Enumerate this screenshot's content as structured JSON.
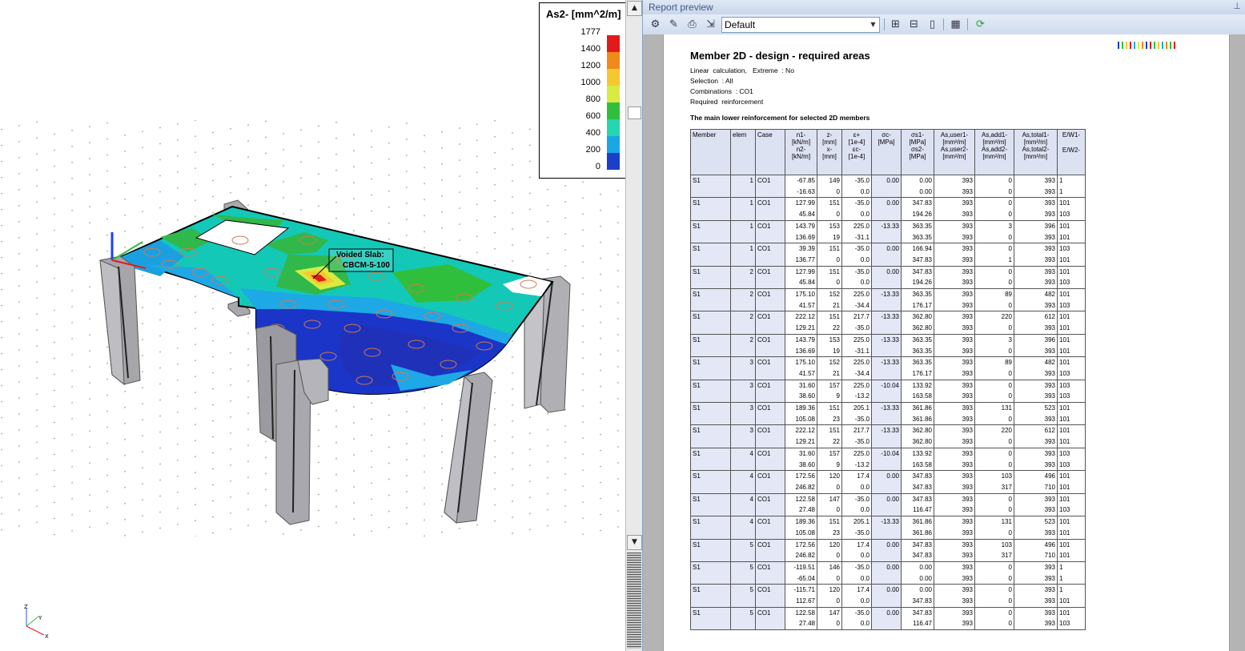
{
  "viewport": {
    "annotation": [
      "Voided Slab:",
      "CBCM-5-100"
    ],
    "axes": {
      "x": "X",
      "y": "Y",
      "z": "Z"
    },
    "legend": {
      "title": "As2- [mm^2/m]",
      "levels": [
        {
          "value": "1777",
          "color": "#e31a1c"
        },
        {
          "value": "1400",
          "color": "#f08a1a"
        },
        {
          "value": "1200",
          "color": "#f6c830"
        },
        {
          "value": "1000",
          "color": "#d9ea40"
        },
        {
          "value": "800",
          "color": "#2fbf3c"
        },
        {
          "value": "600",
          "color": "#25d6b0"
        },
        {
          "value": "400",
          "color": "#1aa7e6"
        },
        {
          "value": "200",
          "color": "#1a3fc8"
        },
        {
          "value": "0",
          "color": "#0d1fa0"
        }
      ]
    }
  },
  "scrollbar": {
    "up": "▲",
    "down": "▼"
  },
  "report": {
    "panel_title": "Report preview",
    "pin_icon": "⊥",
    "template_select": "Default",
    "title": "Member 2D - design - required areas",
    "info_lines": [
      "Linear  calculation,   Extreme  : No",
      "Selection  : All",
      "Combinations  : CO1",
      "Required  reinforcement"
    ],
    "subtitle": "The main  lower  reinforcement   for selected  2D members",
    "columns": [
      [
        "Member"
      ],
      [
        "elem"
      ],
      [
        "Case"
      ],
      [
        "n1-",
        "[kN/m]",
        "n2-",
        "[kN/m]"
      ],
      [
        "z-",
        "[mm]",
        "x-",
        "[mm]"
      ],
      [
        "ε+",
        "[1e-4]",
        "εc-",
        "[1e-4]"
      ],
      [
        "σc-",
        "[MPa]"
      ],
      [
        "σs1-",
        "[MPa]",
        "σs2-",
        "[MPa]"
      ],
      [
        "As,user1-",
        "[mm²/m]",
        "As,user2-",
        "[mm²/m]"
      ],
      [
        "As,add1-",
        "[mm²/m]",
        "As,add2-",
        "[mm²/m]"
      ],
      [
        "As,total1-",
        "[mm²/m]",
        "As,total2-",
        "[mm²/m]"
      ],
      [
        "E/W1-",
        "",
        "E/W2-"
      ]
    ],
    "rows": [
      {
        "member": "S1",
        "elem": "1",
        "case": "CO1",
        "a": [
          "-67.85",
          "149",
          "-35.0",
          "0.00",
          "0.00",
          "393",
          "0",
          "393",
          "1"
        ],
        "b": [
          "-16.63",
          "0",
          "0.0",
          "",
          "0.00",
          "393",
          "0",
          "393",
          "1"
        ]
      },
      {
        "member": "S1",
        "elem": "1",
        "case": "CO1",
        "a": [
          "127.99",
          "151",
          "-35.0",
          "0.00",
          "347.83",
          "393",
          "0",
          "393",
          "101"
        ],
        "b": [
          "45.84",
          "0",
          "0.0",
          "",
          "194.26",
          "393",
          "0",
          "393",
          "103"
        ]
      },
      {
        "member": "S1",
        "elem": "1",
        "case": "CO1",
        "a": [
          "143.79",
          "153",
          "225.0",
          "-13.33",
          "363.35",
          "393",
          "3",
          "396",
          "101"
        ],
        "b": [
          "136.69",
          "19",
          "-31.1",
          "",
          "363.35",
          "393",
          "0",
          "393",
          "101"
        ]
      },
      {
        "member": "S1",
        "elem": "1",
        "case": "CO1",
        "a": [
          "39.39",
          "151",
          "-35.0",
          "0.00",
          "166.94",
          "393",
          "0",
          "393",
          "103"
        ],
        "b": [
          "136.77",
          "0",
          "0.0",
          "",
          "347.83",
          "393",
          "1",
          "393",
          "101"
        ]
      },
      {
        "member": "S1",
        "elem": "2",
        "case": "CO1",
        "a": [
          "127.99",
          "151",
          "-35.0",
          "0.00",
          "347.83",
          "393",
          "0",
          "393",
          "101"
        ],
        "b": [
          "45.84",
          "0",
          "0.0",
          "",
          "194.26",
          "393",
          "0",
          "393",
          "103"
        ]
      },
      {
        "member": "S1",
        "elem": "2",
        "case": "CO1",
        "a": [
          "175.10",
          "152",
          "225.0",
          "-13.33",
          "363.35",
          "393",
          "89",
          "482",
          "101"
        ],
        "b": [
          "41.57",
          "21",
          "-34.4",
          "",
          "176.17",
          "393",
          "0",
          "393",
          "103"
        ]
      },
      {
        "member": "S1",
        "elem": "2",
        "case": "CO1",
        "a": [
          "222.12",
          "151",
          "217.7",
          "-13.33",
          "362.80",
          "393",
          "220",
          "612",
          "101"
        ],
        "b": [
          "129.21",
          "22",
          "-35.0",
          "",
          "362.80",
          "393",
          "0",
          "393",
          "101"
        ]
      },
      {
        "member": "S1",
        "elem": "2",
        "case": "CO1",
        "a": [
          "143.79",
          "153",
          "225.0",
          "-13.33",
          "363.35",
          "393",
          "3",
          "396",
          "101"
        ],
        "b": [
          "136.69",
          "19",
          "-31.1",
          "",
          "363.35",
          "393",
          "0",
          "393",
          "101"
        ]
      },
      {
        "member": "S1",
        "elem": "3",
        "case": "CO1",
        "a": [
          "175.10",
          "152",
          "225.0",
          "-13.33",
          "363.35",
          "393",
          "89",
          "482",
          "101"
        ],
        "b": [
          "41.57",
          "21",
          "-34.4",
          "",
          "176.17",
          "393",
          "0",
          "393",
          "103"
        ]
      },
      {
        "member": "S1",
        "elem": "3",
        "case": "CO1",
        "a": [
          "31.60",
          "157",
          "225.0",
          "-10.04",
          "133.92",
          "393",
          "0",
          "393",
          "103"
        ],
        "b": [
          "38.60",
          "9",
          "-13.2",
          "",
          "163.58",
          "393",
          "0",
          "393",
          "103"
        ]
      },
      {
        "member": "S1",
        "elem": "3",
        "case": "CO1",
        "a": [
          "189.36",
          "151",
          "205.1",
          "-13.33",
          "361.86",
          "393",
          "131",
          "523",
          "101"
        ],
        "b": [
          "105.08",
          "23",
          "-35.0",
          "",
          "361.86",
          "393",
          "0",
          "393",
          "101"
        ]
      },
      {
        "member": "S1",
        "elem": "3",
        "case": "CO1",
        "a": [
          "222.12",
          "151",
          "217.7",
          "-13.33",
          "362.80",
          "393",
          "220",
          "612",
          "101"
        ],
        "b": [
          "129.21",
          "22",
          "-35.0",
          "",
          "362.80",
          "393",
          "0",
          "393",
          "101"
        ]
      },
      {
        "member": "S1",
        "elem": "4",
        "case": "CO1",
        "a": [
          "31.60",
          "157",
          "225.0",
          "-10.04",
          "133.92",
          "393",
          "0",
          "393",
          "103"
        ],
        "b": [
          "38.60",
          "9",
          "-13.2",
          "",
          "163.58",
          "393",
          "0",
          "393",
          "103"
        ]
      },
      {
        "member": "S1",
        "elem": "4",
        "case": "CO1",
        "a": [
          "172.56",
          "120",
          "17.4",
          "0.00",
          "347.83",
          "393",
          "103",
          "496",
          "101"
        ],
        "b": [
          "246.82",
          "0",
          "0.0",
          "",
          "347.83",
          "393",
          "317",
          "710",
          "101"
        ]
      },
      {
        "member": "S1",
        "elem": "4",
        "case": "CO1",
        "a": [
          "122.58",
          "147",
          "-35.0",
          "0.00",
          "347.83",
          "393",
          "0",
          "393",
          "101"
        ],
        "b": [
          "27.48",
          "0",
          "0.0",
          "",
          "116.47",
          "393",
          "0",
          "393",
          "103"
        ]
      },
      {
        "member": "S1",
        "elem": "4",
        "case": "CO1",
        "a": [
          "189.36",
          "151",
          "205.1",
          "-13.33",
          "361.86",
          "393",
          "131",
          "523",
          "101"
        ],
        "b": [
          "105.08",
          "23",
          "-35.0",
          "",
          "361.86",
          "393",
          "0",
          "393",
          "101"
        ]
      },
      {
        "member": "S1",
        "elem": "5",
        "case": "CO1",
        "a": [
          "172.56",
          "120",
          "17.4",
          "0.00",
          "347.83",
          "393",
          "103",
          "496",
          "101"
        ],
        "b": [
          "246.82",
          "0",
          "0.0",
          "",
          "347.83",
          "393",
          "317",
          "710",
          "101"
        ]
      },
      {
        "member": "S1",
        "elem": "5",
        "case": "CO1",
        "a": [
          "-119.51",
          "146",
          "-35.0",
          "0.00",
          "0.00",
          "393",
          "0",
          "393",
          "1"
        ],
        "b": [
          "-65.04",
          "0",
          "0.0",
          "",
          "0.00",
          "393",
          "0",
          "393",
          "1"
        ]
      },
      {
        "member": "S1",
        "elem": "5",
        "case": "CO1",
        "a": [
          "-115.71",
          "120",
          "17.4",
          "0.00",
          "0.00",
          "393",
          "0",
          "393",
          "1"
        ],
        "b": [
          "112.67",
          "0",
          "0.0",
          "",
          "347.83",
          "393",
          "0",
          "393",
          "101"
        ]
      },
      {
        "member": "S1",
        "elem": "5",
        "case": "CO1",
        "a": [
          "122.58",
          "147",
          "-35.0",
          "0.00",
          "347.83",
          "393",
          "0",
          "393",
          "101"
        ],
        "b": [
          "27.48",
          "0",
          "0.0",
          "",
          "116.47",
          "393",
          "0",
          "393",
          "103"
        ]
      }
    ]
  }
}
